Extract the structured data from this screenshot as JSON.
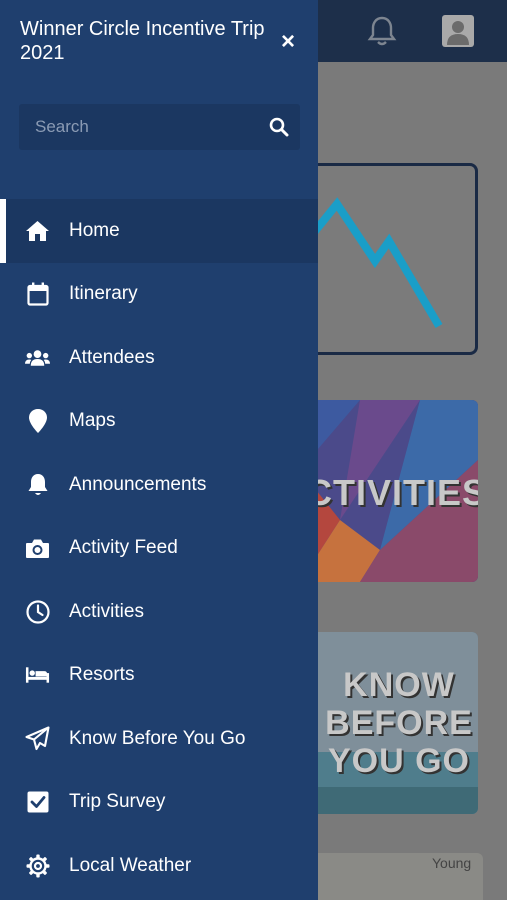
{
  "drawer": {
    "title": "Winner Circle Incentive Trip 2021",
    "close_label": "×",
    "search": {
      "placeholder": "Search"
    },
    "items": [
      {
        "label": "Home",
        "icon": "home-icon",
        "active": true
      },
      {
        "label": "Itinerary",
        "icon": "calendar-icon"
      },
      {
        "label": "Attendees",
        "icon": "users-icon"
      },
      {
        "label": "Maps",
        "icon": "map-pin-icon"
      },
      {
        "label": "Announcements",
        "icon": "bell-icon"
      },
      {
        "label": "Activity Feed",
        "icon": "camera-icon"
      },
      {
        "label": "Activities",
        "icon": "clock-icon"
      },
      {
        "label": "Resorts",
        "icon": "bed-icon"
      },
      {
        "label": "Know Before You Go",
        "icon": "paper-plane-icon"
      },
      {
        "label": "Trip Survey",
        "icon": "checkbox-icon"
      },
      {
        "label": "Local Weather",
        "icon": "gear-icon"
      }
    ]
  },
  "background": {
    "cards": {
      "activities": "CTIVITIES",
      "know_before_line1": "KNOW",
      "know_before_line2": "BEFORE",
      "know_before_line3": "YOU GO",
      "map_label": "Young"
    }
  },
  "colors": {
    "drawer_bg": "#1f3f6e",
    "active_item_bg": "#1b3761",
    "header_bg": "#1d2f4a",
    "logo_accent": "#1a9ec8"
  }
}
